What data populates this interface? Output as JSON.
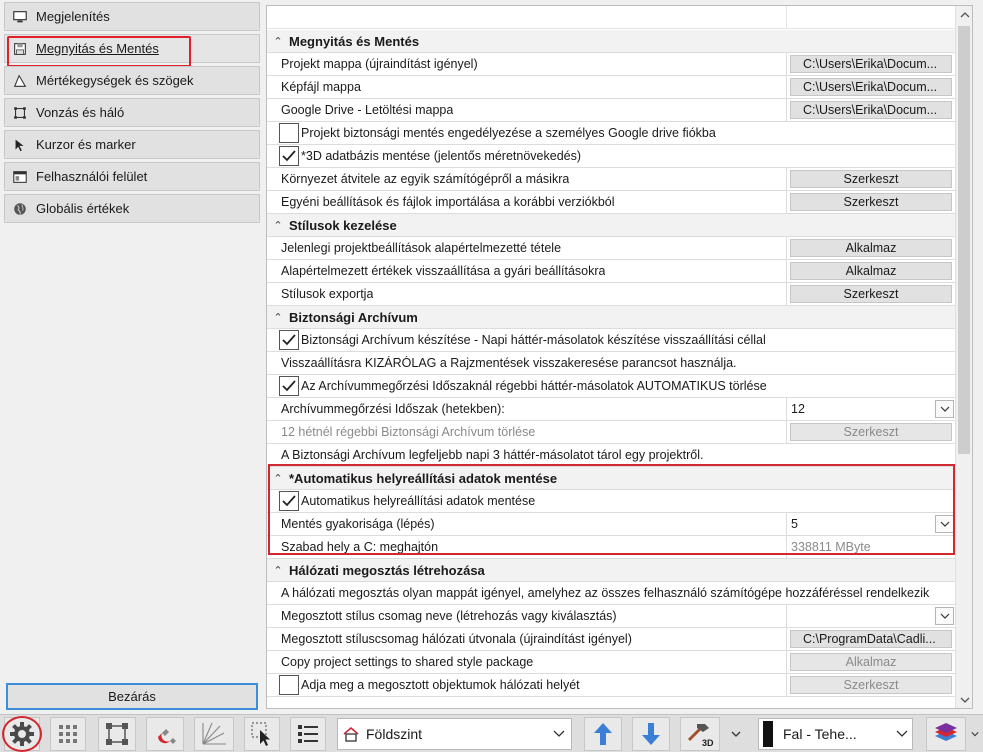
{
  "sidebar": {
    "items": [
      {
        "label": "Megjelenítés",
        "icon": "monitor-icon"
      },
      {
        "label": "Megnyitás és Mentés",
        "icon": "floppy-icon",
        "active": true
      },
      {
        "label": "Mértékegységek és szögek",
        "icon": "triangle-ruler-icon"
      },
      {
        "label": "Vonzás és háló",
        "icon": "snap-grid-icon"
      },
      {
        "label": "Kurzor és marker",
        "icon": "cursor-icon"
      },
      {
        "label": "Felhasználói felület",
        "icon": "window-icon"
      },
      {
        "label": "Globális értékek",
        "icon": "globe-icon"
      }
    ],
    "close_label": "Bezárás"
  },
  "sections": {
    "open_save": {
      "title": "Megnyitás és Mentés",
      "project_folder": {
        "label": "Projekt mappa (újraindítást igényel)",
        "value": "C:\\Users\\Erika\\Docum..."
      },
      "image_folder": {
        "label": "Képfájl mappa",
        "value": "C:\\Users\\Erika\\Docum..."
      },
      "gdrive_folder": {
        "label": "Google Drive - Letöltési mappa",
        "value": "C:\\Users\\Erika\\Docum..."
      },
      "gdrive_backup": {
        "label": "Projekt biztonsági mentés engedélyezése a személyes Google drive fiókba",
        "checked": false
      },
      "save_3d": {
        "label": "*3D adatbázis mentése (jelentős méretnövekedés)",
        "checked": true
      },
      "env_transfer": {
        "label": "Környezet átvitele az egyik számítógépről a másikra",
        "button": "Szerkeszt"
      },
      "import_settings": {
        "label": "Egyéni beállítások és fájlok importálása a korábbi verziókból",
        "button": "Szerkeszt"
      }
    },
    "styles": {
      "title": "Stílusok kezelése",
      "set_default": {
        "label": "Jelenlegi projektbeállítások alapértelmezetté tétele",
        "button": "Alkalmaz"
      },
      "restore_factory": {
        "label": "Alapértelmezett értékek visszaállítása a gyári beállításokra",
        "button": "Alkalmaz"
      },
      "export_styles": {
        "label": "Stílusok exportja",
        "button": "Szerkeszt"
      }
    },
    "backup": {
      "title": "Biztonsági Archívum",
      "create_backup": {
        "label": "Biztonsági Archívum készítése - Napi háttér-másolatok készítése visszaállítási céllal",
        "checked": true
      },
      "restore_info": "Visszaállításra KIZÁRÓLAG a Rajzmentések visszakeresése parancsot használja.",
      "auto_delete": {
        "label": "Az Archívummegőrzési Időszaknál régebbi háttér-másolatok AUTOMATIKUS törlése",
        "checked": true
      },
      "retention": {
        "label": "Archívummegőrzési Időszak (hetekben):",
        "value": "12"
      },
      "delete_older": {
        "label": "12 hétnél régebbi Biztonsági Archívum törlése",
        "button": "Szerkeszt"
      },
      "max_info": "A Biztonsági Archívum legfeljebb napi 3 háttér-másolatot tárol egy projektről."
    },
    "autosave": {
      "title": "*Automatikus helyreállítási adatok mentése",
      "enable": {
        "label": "Automatikus helyreállítási adatok mentése",
        "checked": true
      },
      "frequency": {
        "label": "Mentés gyakorisága (lépés)",
        "value": "5"
      },
      "free_space": {
        "label": "Szabad hely a C: meghajtón",
        "value": "338811 MByte"
      }
    },
    "network": {
      "title": "Hálózati megosztás létrehozása",
      "info": "A hálózati megosztás olyan mappát igényel, amelyhez az összes felhasználó számítógépe hozzáféréssel rendelkezik",
      "package_name": {
        "label": "Megosztott stílus csomag neve (létrehozás vagy kiválasztás)",
        "value": ""
      },
      "package_path": {
        "label": "Megosztott stíluscsomag hálózati útvonala (újraindítást igényel)",
        "value": "C:\\ProgramData\\Cadli..."
      },
      "copy_settings": {
        "label": "Copy project settings to shared style package",
        "button": "Alkalmaz"
      },
      "object_path": {
        "label": "Adja meg a megosztott objektumok hálózati helyét",
        "checked": false,
        "button": "Szerkeszt"
      }
    }
  },
  "toolbar": {
    "layer_name": "Földszint",
    "wall_type": "Fal - Tehe..."
  },
  "colors": {
    "highlight": "#d32730",
    "focus": "#3c8fd6",
    "arrow_blue": "#3a7fd5"
  }
}
